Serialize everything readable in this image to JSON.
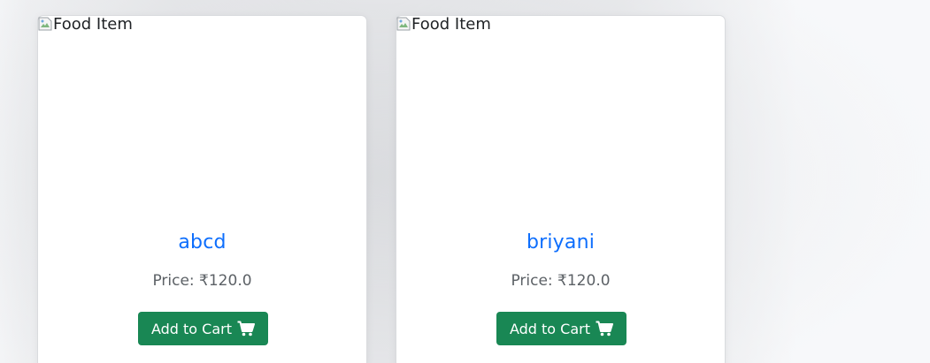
{
  "cards": [
    {
      "image_alt": "Food Item",
      "title": "abcd",
      "price": "Price: ₹120.0",
      "button_label": "Add to Cart",
      "button_icon": "shopping-cart-icon"
    },
    {
      "image_alt": "Food Item",
      "title": "briyani",
      "price": "Price: ₹120.0",
      "button_label": "Add to Cart",
      "button_icon": "shopping-cart-icon"
    }
  ],
  "colors": {
    "title": "#0d6efd",
    "button": "#198754",
    "price": "#5c6166"
  }
}
